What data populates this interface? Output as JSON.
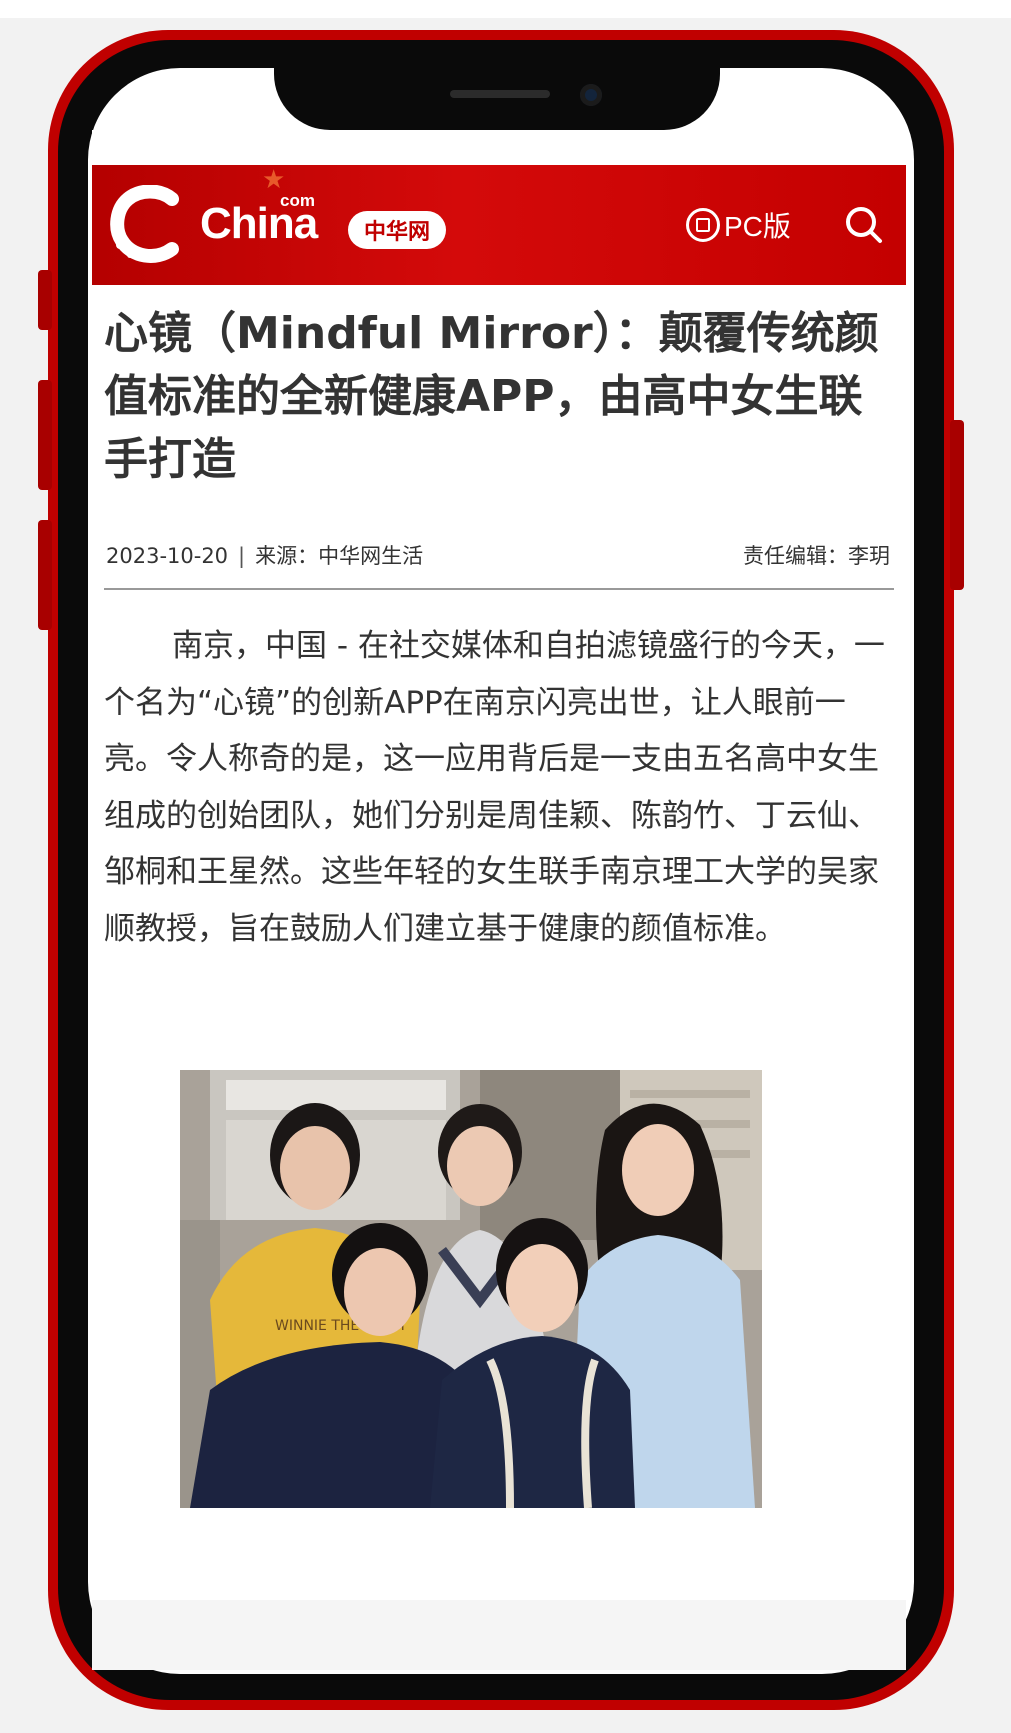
{
  "site": {
    "logo_com": "com",
    "logo_name": "China",
    "logo_badge": "中华网",
    "pc_label": "PC版",
    "search_icon": "search-icon",
    "brand_color": "#c00000"
  },
  "article": {
    "title": "心镜（Mindful Mirror）：颠覆传统颜值标准的全新健康APP，由高中女生联手打造",
    "date": "2023-10-20",
    "separator": "|",
    "source": "来源：中华网生活",
    "editor": "责任编辑：李玥",
    "body": "南京，中国 - 在社交媒体和自拍滤镜盛行的今天，一个名为“心镜”的创新APP在南京闪亮出世，让人眼前一亮。令人称奇的是，这一应用背后是一支由五名高中女生组成的创始团队，她们分别是周佳颖、陈韵竹、丁云仙、邹桐和王星然。这些年轻的女生联手南京理工大学的吴家顺教授，旨在鼓励人们建立基于健康的颜值标准。",
    "photo_text": "WINNIE THE POOH"
  }
}
